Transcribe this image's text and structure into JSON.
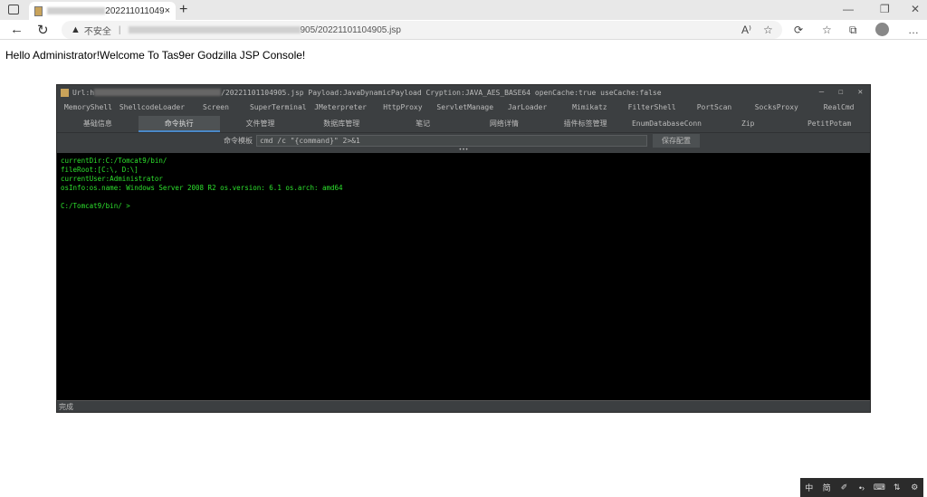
{
  "browser": {
    "tab_title": "202211011049",
    "url_visible": "905/20221101104905.jsp",
    "security_label": "不安全",
    "new_tab": "+",
    "close_tab": "×",
    "icons": [
      "tab-actions-icon",
      "back-icon",
      "refresh-icon",
      "warning-icon",
      "read-aloud-icon",
      "favorite-add-icon",
      "extensions-icon",
      "favorites-icon",
      "collections-icon",
      "profile-avatar",
      "minimize-icon",
      "maximize-icon",
      "close-icon"
    ]
  },
  "page": {
    "greeting": "Hello Administrator!Welcome To Tas9er Godzilla JSP Console!"
  },
  "console": {
    "title": "Url:h/20221101104905.jsp Payload:JavaDynamicPayload Cryption:JAVA_AES_BASE64 openCache:true useCache:false",
    "title_prefix": "Url:h",
    "title_suffix": "/20221101104905.jsp Payload:JavaDynamicPayload Cryption:JAVA_AES_BASE64 openCache:true useCache:false",
    "plugin_tabs": [
      "MemoryShell",
      "ShellcodeLoader",
      "Screen",
      "SuperTerminal",
      "JMeterpreter",
      "HttpProxy",
      "ServletManage",
      "JarLoader",
      "Mimikatz",
      "FilterShell",
      "PortScan",
      "SocksProxy",
      "RealCmd"
    ],
    "main_tabs": [
      "基础信息",
      "命令执行",
      "文件管理",
      "数据库管理",
      "笔记",
      "网络详情",
      "插件标签管理",
      "EnumDatabaseConn",
      "Zip",
      "PetitPotam"
    ],
    "selected_tab": "命令执行",
    "cmd_template_label": "命令模板",
    "cmd_template_value": "cmd /c \"{command}\" 2>&1",
    "save_button": "保存配置",
    "handle": "•••",
    "terminal_lines": [
      "currentDir:C:/Tomcat9/bin/",
      "fileRoot:[C:\\, D:\\]",
      "currentUser:Administrator",
      "osInfo:os.name: Windows Server 2008 R2 os.version: 6.1 os.arch: amd64",
      "",
      "C:/Tomcat9/bin/ >"
    ],
    "status": "完成",
    "terminal_text_color": "#2de02d"
  },
  "ime_toolbar": {
    "items": [
      "中",
      "简",
      "✐",
      "•›",
      "⌨",
      "⇅",
      "⚙"
    ]
  }
}
